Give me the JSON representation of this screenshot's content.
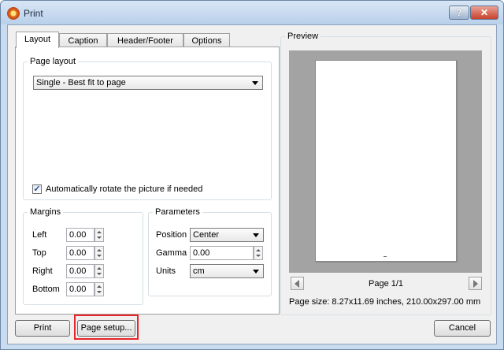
{
  "window": {
    "title": "Print",
    "help_label": "?",
    "close_label": "✕"
  },
  "tabs": [
    {
      "label": "Layout",
      "active": true
    },
    {
      "label": "Caption",
      "active": false
    },
    {
      "label": "Header/Footer",
      "active": false
    },
    {
      "label": "Options",
      "active": false
    }
  ],
  "layout": {
    "group_label": "Page layout",
    "layout_select": "Single - Best fit to page",
    "auto_rotate_label": "Automatically rotate the picture if needed",
    "auto_rotate_checked": "✓"
  },
  "margins": {
    "group_label": "Margins",
    "left_label": "Left",
    "left_value": "0.00",
    "top_label": "Top",
    "top_value": "0.00",
    "right_label": "Right",
    "right_value": "0.00",
    "bottom_label": "Bottom",
    "bottom_value": "0.00"
  },
  "parameters": {
    "group_label": "Parameters",
    "position_label": "Position",
    "position_value": "Center",
    "gamma_label": "Gamma",
    "gamma_value": "0.00",
    "units_label": "Units",
    "units_value": "cm"
  },
  "preview": {
    "group_label": "Preview",
    "page_indicator": "Page 1/1",
    "page_size": "Page size: 8.27x11.69 inches, 210.00x297.00 mm"
  },
  "buttons": {
    "print": "Print",
    "page_setup": "Page setup...",
    "cancel": "Cancel"
  }
}
